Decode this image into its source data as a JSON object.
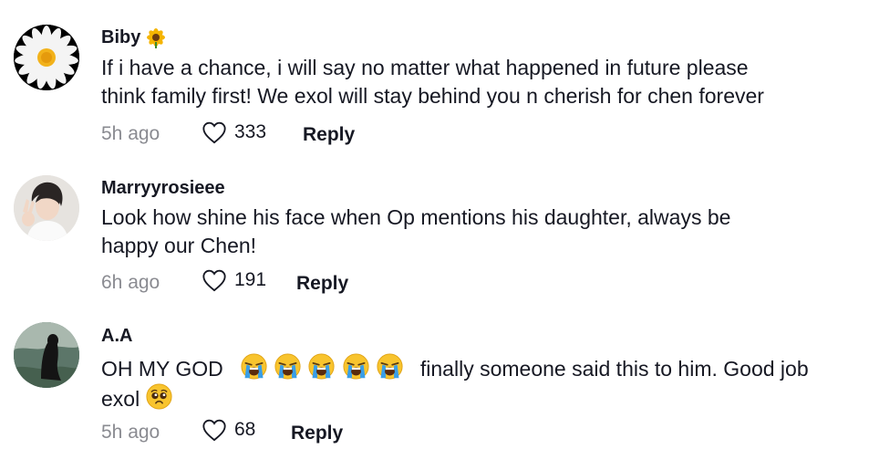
{
  "comments": [
    {
      "username": "Biby",
      "username_icon": "sunflower-icon",
      "text_lines": [
        "If i have a chance, i will say no matter what happened in future please",
        "think family first! We exol will stay behind you n cherish for chen forever"
      ],
      "time": "5h ago",
      "likes": "333",
      "reply_label": "Reply",
      "avatar": "daisy-avatar"
    },
    {
      "username": "Marryyrosieee",
      "text_lines": [
        "Look how shine his face when Op mentions his daughter, always be",
        "happy our Chen!"
      ],
      "time": "6h ago",
      "likes": "191",
      "reply_label": "Reply",
      "avatar": "person-avatar"
    },
    {
      "username": "A.A",
      "text_prefix": "OH MY GOD",
      "text_suffix": "finally someone said this to him. Good job",
      "text_line2": "exol",
      "emoji_crying": "loudly-crying-face-icon",
      "emoji_pleading": "pleading-face-icon",
      "time": "5h ago",
      "likes": "68",
      "reply_label": "Reply",
      "avatar": "nature-avatar"
    }
  ]
}
